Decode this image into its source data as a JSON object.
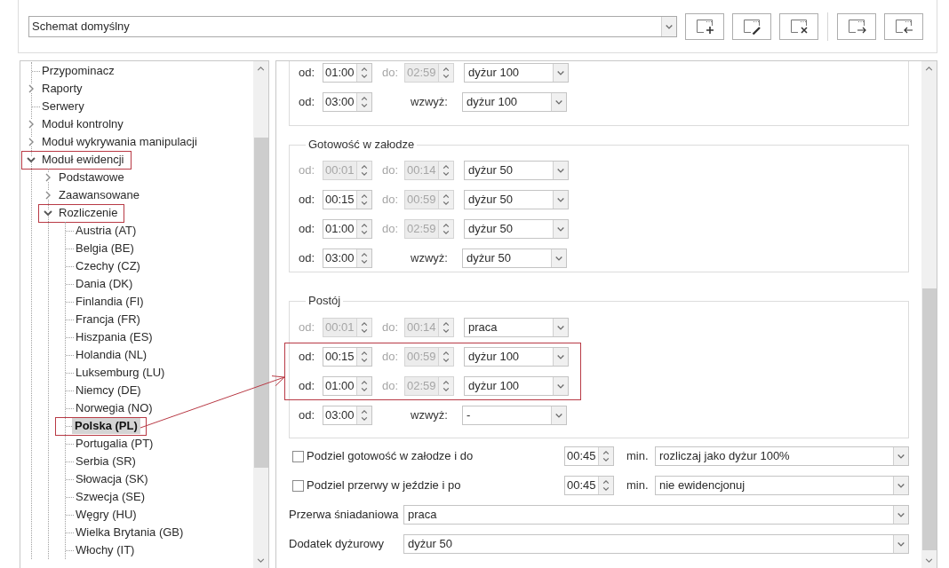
{
  "scheme_selector": {
    "value": "Schemat domyślny"
  },
  "tree": {
    "items": [
      {
        "label": "Przypominacz",
        "kind": "leaf",
        "selected": false,
        "marked": false
      },
      {
        "label": "Raporty",
        "kind": "branch",
        "expanded": false,
        "selected": false,
        "marked": false
      },
      {
        "label": "Serwery",
        "kind": "leaf",
        "selected": false,
        "marked": false
      },
      {
        "label": "Moduł kontrolny",
        "kind": "branch",
        "expanded": false,
        "selected": false,
        "marked": false
      },
      {
        "label": "Moduł wykrywania manipulacji",
        "kind": "branch",
        "expanded": false,
        "selected": false,
        "marked": false
      },
      {
        "label": "Moduł ewidencji",
        "kind": "branch",
        "expanded": true,
        "selected": false,
        "marked": true,
        "children": [
          {
            "label": "Podstawowe",
            "kind": "branch",
            "expanded": false,
            "selected": false,
            "marked": false
          },
          {
            "label": "Zaawansowane",
            "kind": "branch",
            "expanded": false,
            "selected": false,
            "marked": false
          },
          {
            "label": "Rozliczenie",
            "kind": "branch",
            "expanded": true,
            "selected": false,
            "marked": true,
            "children": [
              {
                "label": "Austria (AT)",
                "kind": "leaf",
                "selected": false,
                "marked": false
              },
              {
                "label": "Belgia (BE)",
                "kind": "leaf",
                "selected": false,
                "marked": false
              },
              {
                "label": "Czechy (CZ)",
                "kind": "leaf",
                "selected": false,
                "marked": false
              },
              {
                "label": "Dania (DK)",
                "kind": "leaf",
                "selected": false,
                "marked": false
              },
              {
                "label": "Finlandia (FI)",
                "kind": "leaf",
                "selected": false,
                "marked": false
              },
              {
                "label": "Francja (FR)",
                "kind": "leaf",
                "selected": false,
                "marked": false
              },
              {
                "label": "Hiszpania (ES)",
                "kind": "leaf",
                "selected": false,
                "marked": false
              },
              {
                "label": "Holandia (NL)",
                "kind": "leaf",
                "selected": false,
                "marked": false
              },
              {
                "label": "Luksemburg (LU)",
                "kind": "leaf",
                "selected": false,
                "marked": false
              },
              {
                "label": "Niemcy (DE)",
                "kind": "leaf",
                "selected": false,
                "marked": false
              },
              {
                "label": "Norwegia (NO)",
                "kind": "leaf",
                "selected": false,
                "marked": false
              },
              {
                "label": "Polska (PL)",
                "kind": "leaf",
                "selected": true,
                "marked": true
              },
              {
                "label": "Portugalia (PT)",
                "kind": "leaf",
                "selected": false,
                "marked": false
              },
              {
                "label": "Serbia (SR)",
                "kind": "leaf",
                "selected": false,
                "marked": false
              },
              {
                "label": "Słowacja (SK)",
                "kind": "leaf",
                "selected": false,
                "marked": false
              },
              {
                "label": "Szwecja (SE)",
                "kind": "leaf",
                "selected": false,
                "marked": false
              },
              {
                "label": "Węgry (HU)",
                "kind": "leaf",
                "selected": false,
                "marked": false
              },
              {
                "label": "Wielka Brytania (GB)",
                "kind": "leaf",
                "selected": false,
                "marked": false
              },
              {
                "label": "Włochy (IT)",
                "kind": "leaf",
                "selected": false,
                "marked": false
              }
            ]
          }
        ]
      }
    ]
  },
  "settings": {
    "groups": [
      {
        "rows": [
          {
            "kind": "range",
            "from_label": "od:",
            "from": {
              "value": "01:00",
              "disabled": false
            },
            "to_label": "do:",
            "to": {
              "value": "02:59",
              "disabled": true
            },
            "option": "dyżur 100",
            "marked": false
          },
          {
            "kind": "upward",
            "from_label": "od:",
            "from": {
              "value": "03:00",
              "disabled": false
            },
            "upward_label": "wzwyż:",
            "option": "dyżur 100",
            "marked": false
          }
        ]
      },
      {
        "title": "Gotowość w załodze",
        "rows": [
          {
            "kind": "range",
            "from_label": "od:",
            "from": {
              "value": "00:01",
              "disabled": true
            },
            "to_label": "do:",
            "to": {
              "value": "00:14",
              "disabled": true
            },
            "option": "dyżur 50",
            "marked": false
          },
          {
            "kind": "range",
            "from_label": "od:",
            "from": {
              "value": "00:15",
              "disabled": false
            },
            "to_label": "do:",
            "to": {
              "value": "00:59",
              "disabled": true
            },
            "option": "dyżur 50",
            "marked": false
          },
          {
            "kind": "range",
            "from_label": "od:",
            "from": {
              "value": "01:00",
              "disabled": false
            },
            "to_label": "do:",
            "to": {
              "value": "02:59",
              "disabled": true
            },
            "option": "dyżur 50",
            "marked": false
          },
          {
            "kind": "upward",
            "from_label": "od:",
            "from": {
              "value": "03:00",
              "disabled": false
            },
            "upward_label": "wzwyż:",
            "option": "dyżur 50",
            "marked": false
          }
        ]
      },
      {
        "title": "Postój",
        "rows": [
          {
            "kind": "range",
            "from_label": "od:",
            "from": {
              "value": "00:01",
              "disabled": true
            },
            "to_label": "do:",
            "to": {
              "value": "00:14",
              "disabled": true
            },
            "option": "praca",
            "marked": false
          },
          {
            "kind": "range",
            "from_label": "od:",
            "from": {
              "value": "00:15",
              "disabled": false
            },
            "to_label": "do:",
            "to": {
              "value": "00:59",
              "disabled": true
            },
            "option": "dyżur 100",
            "marked": true
          },
          {
            "kind": "range",
            "from_label": "od:",
            "from": {
              "value": "01:00",
              "disabled": false
            },
            "to_label": "do:",
            "to": {
              "value": "02:59",
              "disabled": true
            },
            "option": "dyżur 100",
            "marked": true
          },
          {
            "kind": "upward",
            "from_label": "od:",
            "from": {
              "value": "03:00",
              "disabled": false
            },
            "upward_label": "wzwyż:",
            "option": "-",
            "marked": false
          }
        ]
      }
    ],
    "split_options": [
      {
        "label": "Podziel gotowość w załodze i do",
        "checked": false,
        "time": {
          "value": "00:45",
          "disabled": false
        },
        "unit": "min.",
        "option": "rozliczaj jako dyżur 100%"
      },
      {
        "label": "Podziel przerwy w jeździe i po",
        "checked": false,
        "time": {
          "value": "00:45",
          "disabled": false
        },
        "unit": "min.",
        "option": "nie ewidencjonuj"
      }
    ],
    "fields": [
      {
        "label": "Przerwa śniadaniowa",
        "value": "praca"
      },
      {
        "label": "Dodatek dyżurowy",
        "value": "dyżur 50"
      }
    ]
  }
}
